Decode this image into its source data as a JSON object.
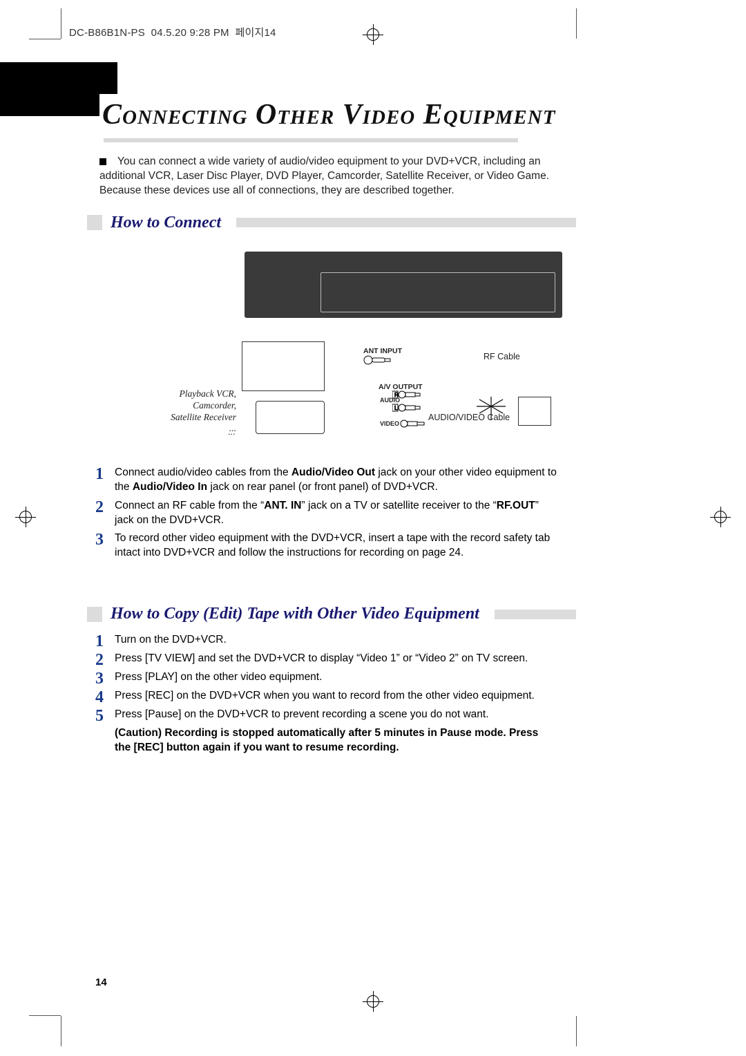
{
  "header": {
    "slug": "DC-B86B1N-PS  04.5.20 9:28 PM  페이지14"
  },
  "title": "Connecting Other Video Equipment",
  "intro": "You can connect a wide variety of audio/video equipment to your DVD+VCR, including an additional VCR, Laser Disc Player, DVD Player, Camcorder, Satellite Receiver, or Video Game. Because these devices use all of connections, they are described together.",
  "sections": {
    "connect": {
      "heading": "How to Connect",
      "diagram": {
        "ant_input": "ANT INPUT",
        "rf_cable": "RF Cable",
        "av_output": "A/V OUTPUT",
        "audio": "AUDIO",
        "video": "VIDEO",
        "av_cable": "AUDIO/VIDEO Cable",
        "source_label": "Playback VCR, Camcorder, Satellite Receiver ...",
        "dots": "..."
      },
      "steps": [
        {
          "num": "1",
          "pre": "Connect audio/video cables from the ",
          "b1": "Audio/Video Out",
          "mid": " jack on your other video equipment to the ",
          "b2": "Audio/Video In",
          "post": " jack on rear panel (or front panel) of DVD+VCR."
        },
        {
          "num": "2",
          "pre": "Connect an RF cable from the “",
          "b1": "ANT. IN",
          "mid": "” jack on a TV or satellite receiver to the “",
          "b2": "RF.OUT",
          "post": "” jack on the DVD+VCR."
        },
        {
          "num": "3",
          "text": "To record other video equipment with the DVD+VCR, insert a tape with the record safety tab intact into DVD+VCR and follow the instructions for recording on page 24."
        }
      ]
    },
    "copy": {
      "heading": "How to Copy (Edit) Tape with Other Video Equipment",
      "steps": [
        {
          "num": "1",
          "text": "Turn on the DVD+VCR."
        },
        {
          "num": "2",
          "text": "Press [TV VIEW] and set the DVD+VCR to display “Video 1” or “Video 2” on TV screen."
        },
        {
          "num": "3",
          "text": "Press [PLAY] on the other video equipment."
        },
        {
          "num": "4",
          "text": "Press [REC] on the DVD+VCR when you want to record from the other video equipment."
        },
        {
          "num": "5",
          "text": "Press [Pause] on the DVD+VCR to prevent recording a scene you do not want."
        }
      ],
      "caution_label": "(Caution)",
      "caution_text": "Recording is stopped automatically after 5 minutes in Pause mode. Press the [REC] button again if you want to resume recording."
    }
  },
  "page_number": "14"
}
